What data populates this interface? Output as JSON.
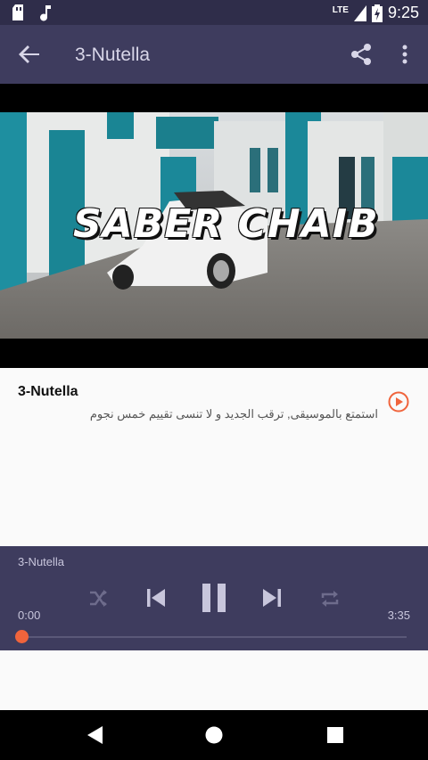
{
  "status": {
    "network": "LTE",
    "battery_level": "charging",
    "time": "9:25"
  },
  "appbar": {
    "title": "3-Nutella"
  },
  "video": {
    "overlay_text": "SABER CHAIB"
  },
  "track": {
    "title": "3-Nutella",
    "subtitle": "استمتع بالموسيقى, ترقب الجديد و لا تنسى تقييم خمس نجوم"
  },
  "player": {
    "now_playing": "3-Nutella",
    "elapsed": "0:00",
    "duration": "3:35",
    "progress": 0.0
  },
  "colors": {
    "accent": "#f0643c",
    "appbar": "#3e3c5e",
    "statusbar": "#2f2d4a"
  }
}
